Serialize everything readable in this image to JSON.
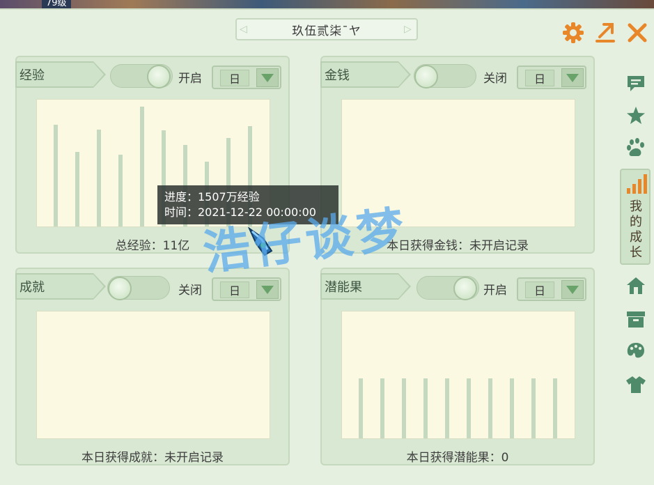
{
  "game_header": {
    "level": "79级"
  },
  "window": {
    "title": "玖伍贰柒ˉヤ"
  },
  "panels": {
    "exp": {
      "tab": "经验",
      "toggle_label": "开启",
      "toggle_on": true,
      "select": "日",
      "summary": "总经验：11亿",
      "bars": [
        0.85,
        0.62,
        0.81,
        0.6,
        1.0,
        0.8,
        0.68,
        0.54,
        0.74,
        0.84
      ]
    },
    "money": {
      "tab": "金钱",
      "toggle_label": "关闭",
      "toggle_on": false,
      "select": "日",
      "summary": "本日获得金钱：未开启记录",
      "bars": []
    },
    "achievement": {
      "tab": "成就",
      "toggle_label": "关闭",
      "toggle_on": false,
      "select": "日",
      "summary": "本日获得成就：未开启记录",
      "bars": []
    },
    "potential": {
      "tab": "潜能果",
      "toggle_label": "开启",
      "toggle_on": true,
      "select": "日",
      "summary": "本日获得潜能果：0",
      "bars": [
        0.5,
        0.5,
        0.5,
        0.5,
        0.5,
        0.5,
        0.5,
        0.5,
        0.5,
        0.5
      ]
    }
  },
  "sidebar": {
    "active_label": "我的成长"
  },
  "tooltip": {
    "line1": "进度：1507万经验",
    "line2": "时间：2021-12-22 00:00:00"
  },
  "watermark": "浩仔谈梦",
  "colors": {
    "accent_orange": "#e8862a",
    "panel_bg": "#d8e8d2",
    "plot_bg": "#fbf9e2",
    "bar": "#c4d9c0"
  }
}
